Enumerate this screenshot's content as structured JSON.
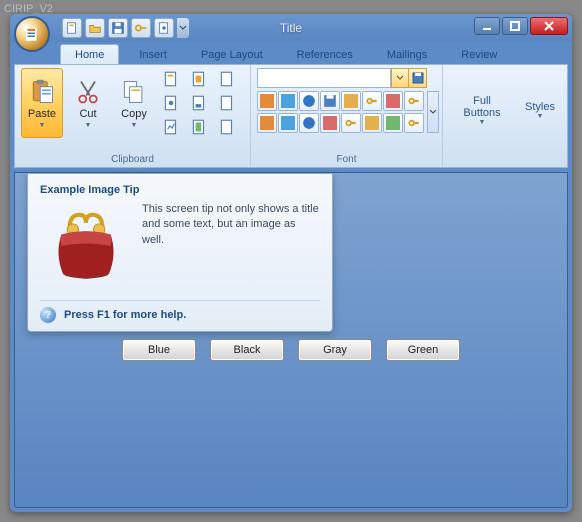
{
  "backdrop_label": "CIRIP_V2",
  "window_title": "Title",
  "tabs": {
    "home": "Home",
    "insert": "Insert",
    "page_layout": "Page Layout",
    "references": "References",
    "mailings": "Mailings",
    "review": "Review"
  },
  "groups": {
    "clipboard": "Clipboard",
    "font": "Font"
  },
  "clipboard_btns": {
    "paste": "Paste",
    "cut": "Cut",
    "copy": "Copy"
  },
  "side": {
    "full_buttons": "Full Buttons",
    "styles": "Styles"
  },
  "font_combo_value": "",
  "tip": {
    "title": "Example Image Tip",
    "body": "This screen tip not only shows a title and some text, but an image as well.",
    "help": "Press F1 for more help."
  },
  "color_buttons": {
    "blue": "Blue",
    "black": "Black",
    "gray": "Gray",
    "green": "Green"
  }
}
